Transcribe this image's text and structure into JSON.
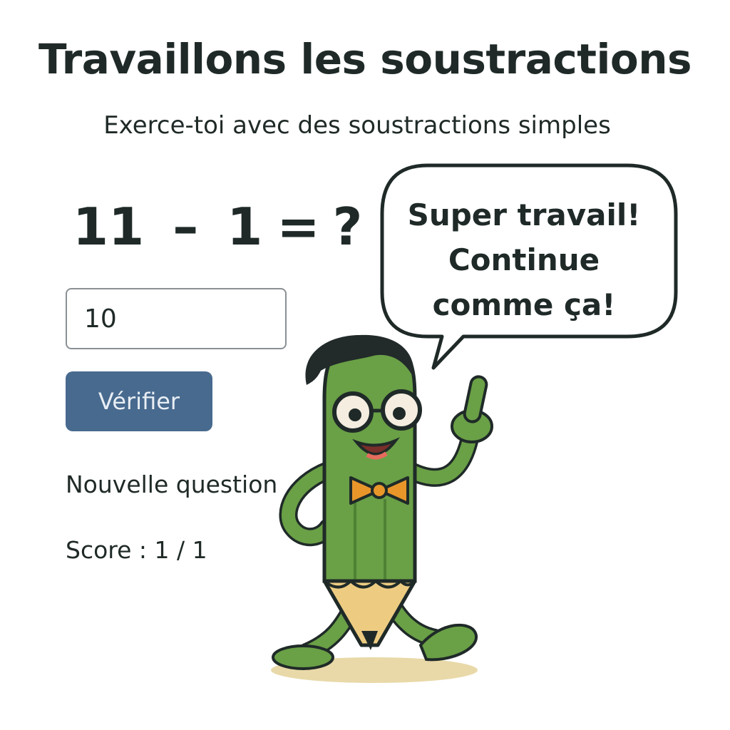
{
  "header": {
    "title": "Travaillons les soustractions",
    "subtitle": "Exerce-toi avec des soustractions simples"
  },
  "exercise": {
    "operand_a": "11",
    "operator": "–",
    "operand_b": "1",
    "equals": "=",
    "question_mark": "?",
    "answer_value": "10",
    "verify_label": "Vérifier",
    "new_question_label": "Nouvelle question",
    "score_text": "Score : 1 / 1"
  },
  "mascot": {
    "speech_lines": [
      "Super travail!",
      "Continue",
      "comme ça!"
    ],
    "colors": {
      "body": "#6aa046",
      "body_dark": "#4f8235",
      "tip": "#edcc82",
      "bowtie": "#e8962a",
      "hair": "#222a2a",
      "shadow": "#e9d9a8"
    }
  },
  "theme": {
    "button_color": "#486a8f",
    "text_color": "#1f2a28"
  }
}
